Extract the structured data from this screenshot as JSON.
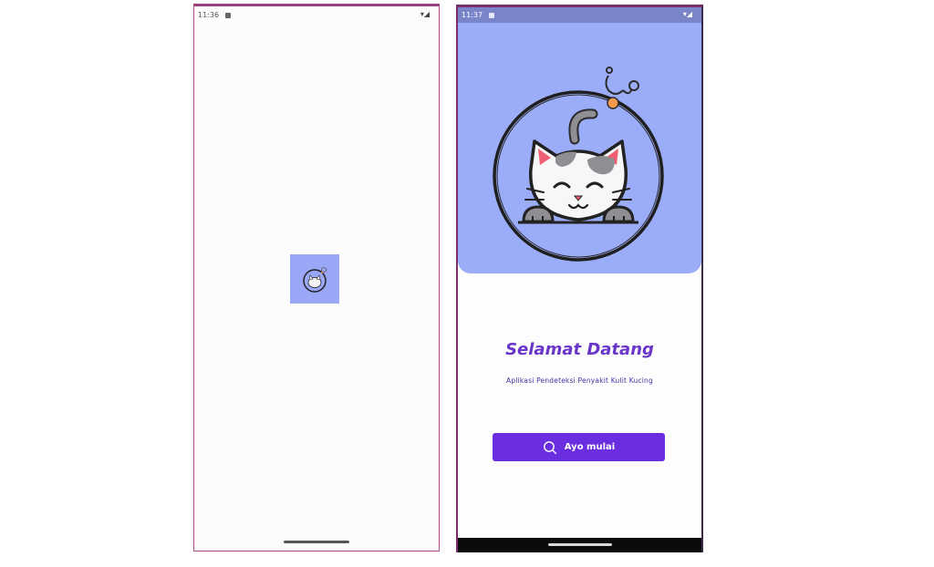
{
  "phone_left": {
    "status": {
      "time": "11:36"
    }
  },
  "phone_right": {
    "status": {
      "time": "11:37"
    },
    "welcome": {
      "title": "Selamat Datang",
      "subtitle": "Aplikasi Pendeteksi Penyakit Kulit Kucing",
      "button_label": "Ayo mulai",
      "button_icon": "search-icon"
    }
  },
  "colors": {
    "hero_bg": "#9badf8",
    "accent": "#6a2ee0",
    "title": "#6a35c9"
  }
}
